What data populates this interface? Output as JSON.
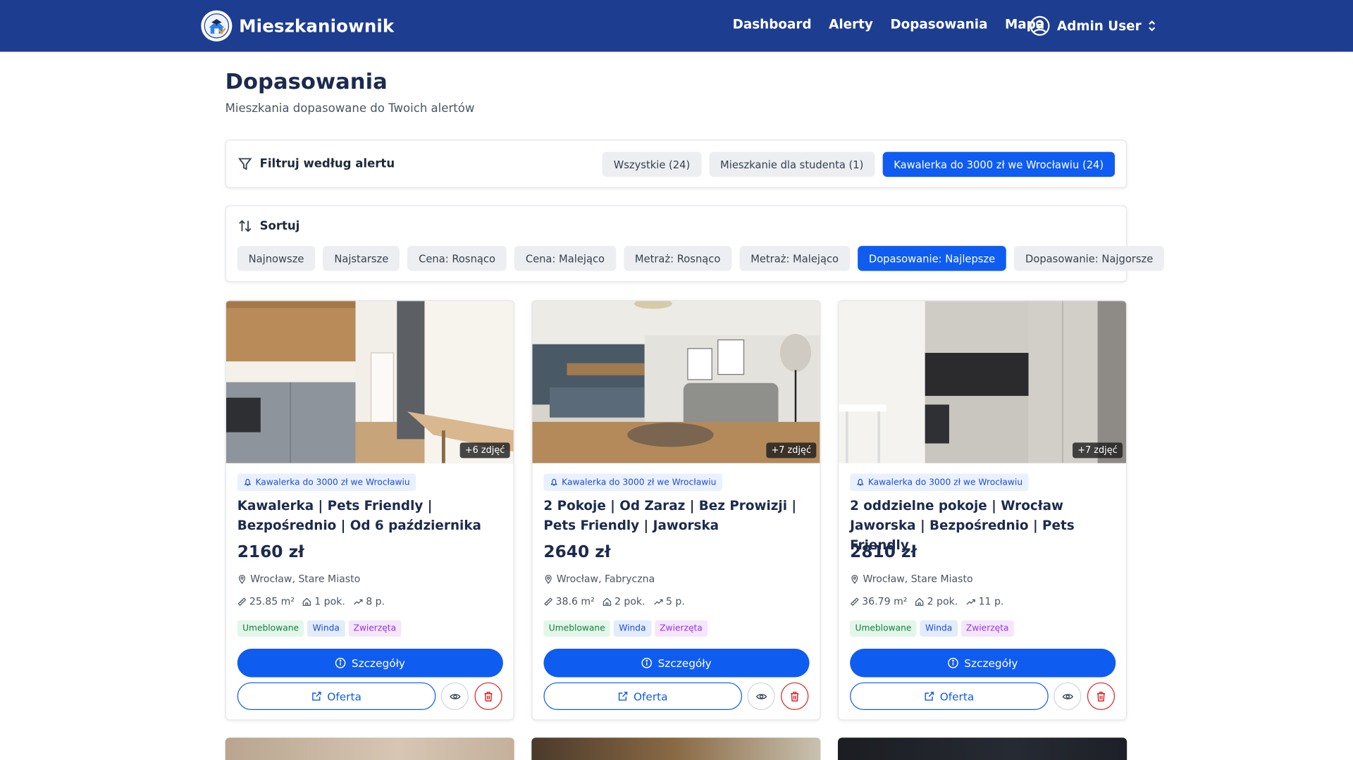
{
  "app": {
    "name": "Mieszkaniownik"
  },
  "nav": {
    "links": [
      "Dashboard",
      "Alerty",
      "Dopasowania",
      "Mapa"
    ],
    "user": "Admin User"
  },
  "page": {
    "title": "Dopasowania",
    "subtitle": "Mieszkania dopasowane do Twoich alertów"
  },
  "filter": {
    "label": "Filtruj według alertu",
    "chips": [
      {
        "label": "Wszystkie (24)",
        "active": false
      },
      {
        "label": "Mieszkanie dla studenta (1)",
        "active": false
      },
      {
        "label": "Kawalerka do 3000 zł we Wrocławiu (24)",
        "active": true
      }
    ]
  },
  "sort": {
    "label": "Sortuj",
    "chips": [
      {
        "label": "Najnowsze",
        "active": false
      },
      {
        "label": "Najstarsze",
        "active": false
      },
      {
        "label": "Cena: Rosnąco",
        "active": false
      },
      {
        "label": "Cena: Malejąco",
        "active": false
      },
      {
        "label": "Metraż: Rosnąco",
        "active": false
      },
      {
        "label": "Metraż: Malejąco",
        "active": false
      },
      {
        "label": "Dopasowanie: Najlepsze",
        "active": true
      },
      {
        "label": "Dopasowanie: Najgorsze",
        "active": false
      }
    ]
  },
  "listings": [
    {
      "photo_count": "+6 zdjęć",
      "alert": "Kawalerka do 3000 zł we Wrocławiu",
      "title": "Kawalerka | Pets Friendly | Bezpośrednio | Od 6 października",
      "price": "2160 zł",
      "location": "Wrocław, Stare Miasto",
      "area": "25.85 m²",
      "rooms": "1 pok.",
      "floor": "8 p.",
      "tags": [
        "Umeblowane",
        "Winda",
        "Zwierzęta"
      ],
      "details_label": "Szczegóły",
      "offer_label": "Oferta"
    },
    {
      "photo_count": "+7 zdjęć",
      "alert": "Kawalerka do 3000 zł we Wrocławiu",
      "title": "2 Pokoje | Od Zaraz | Bez Prowizji | Pets Friendly | Jaworska",
      "price": "2640 zł",
      "location": "Wrocław, Fabryczna",
      "area": "38.6 m²",
      "rooms": "2 pok.",
      "floor": "5 p.",
      "tags": [
        "Umeblowane",
        "Winda",
        "Zwierzęta"
      ],
      "details_label": "Szczegóły",
      "offer_label": "Oferta"
    },
    {
      "photo_count": "+7 zdjęć",
      "alert": "Kawalerka do 3000 zł we Wrocławiu",
      "title": "2 oddzielne pokoje | Wrocław Jaworska | Bezpośrednio | Pets Friendly",
      "price": "2810 zł",
      "location": "Wrocław, Stare Miasto",
      "area": "36.79 m²",
      "rooms": "2 pok.",
      "floor": "11 p.",
      "tags": [
        "Umeblowane",
        "Winda",
        "Zwierzęta"
      ],
      "details_label": "Szczegóły",
      "offer_label": "Oferta"
    }
  ],
  "colors": {
    "navbar": "#1d3d91",
    "primary": "#0f5cf0",
    "danger": "#dc2626"
  }
}
